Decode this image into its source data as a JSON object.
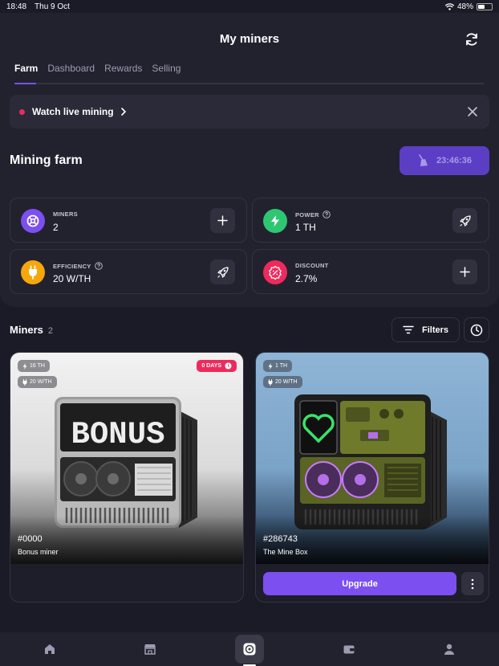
{
  "status_bar": {
    "time": "18:48",
    "date": "Thu 9 Oct",
    "battery": "48%",
    "battery_level": 0.48
  },
  "header": {
    "title": "My miners",
    "refresh_icon": "refresh-icon"
  },
  "tabs": [
    {
      "label": "Farm",
      "active": true
    },
    {
      "label": "Dashboard",
      "active": false
    },
    {
      "label": "Rewards",
      "active": false
    },
    {
      "label": "Selling",
      "active": false
    }
  ],
  "live_banner": {
    "text": "Watch live mining"
  },
  "mining_farm": {
    "title": "Mining farm",
    "timer": "23:46:36"
  },
  "stats": {
    "miners": {
      "label": "MINERS",
      "value": "2"
    },
    "power": {
      "label": "POWER",
      "value": "1 TH"
    },
    "efficiency": {
      "label": "EFFICIENCY",
      "value": "20 W/TH"
    },
    "discount": {
      "label": "DISCOUNT",
      "value": "2.7%"
    }
  },
  "miners_section": {
    "title": "Miners",
    "count": "2",
    "filters_label": "Filters"
  },
  "miner_cards": [
    {
      "power": "16 TH",
      "efficiency": "20 W/TH",
      "days_badge": "0 DAYS",
      "screen_text": "BONUS",
      "id": "#0000",
      "name": "Bonus miner"
    },
    {
      "power": "1 TH",
      "efficiency": "20 W/TH",
      "id": "#286743",
      "name": "The Mine Box",
      "upgrade_label": "Upgrade"
    }
  ],
  "colors": {
    "accent": "#7b4ff0",
    "live_dot": "#ee2a5c",
    "miners_icon": "#7b4ff0",
    "power_icon": "#2fc672",
    "efficiency_icon": "#f5a70c",
    "discount_icon": "#ee2a5c"
  },
  "bottom_nav": [
    "home-icon",
    "store-icon",
    "miners-icon",
    "wallet-icon",
    "profile-icon"
  ]
}
